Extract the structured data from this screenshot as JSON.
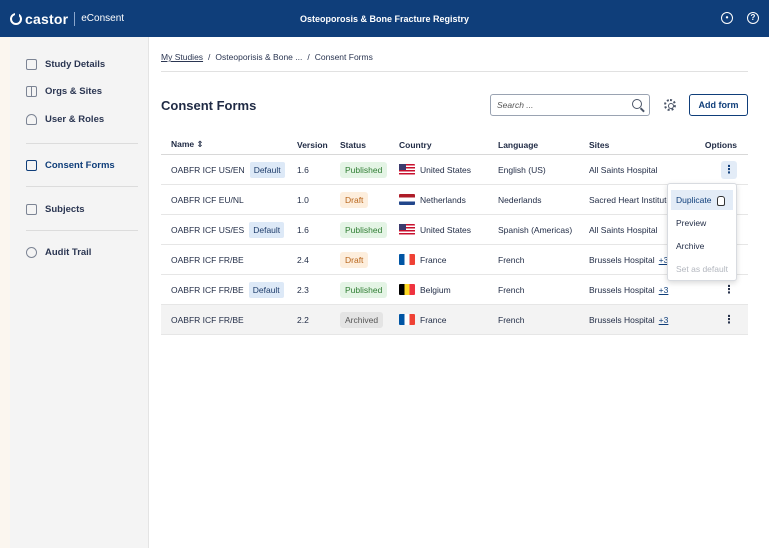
{
  "header": {
    "brand": "castor",
    "product": "eConsent",
    "study_title": "Osteoporosis & Bone Fracture Registry"
  },
  "sidebar": {
    "items": [
      {
        "label": "Study Details",
        "icon": "document-icon"
      },
      {
        "label": "Orgs & Sites",
        "icon": "building-icon"
      },
      {
        "label": "User & Roles",
        "icon": "people-icon"
      },
      {
        "label": "Consent Forms",
        "icon": "clipboard-icon",
        "active": true
      },
      {
        "label": "Subjects",
        "icon": "list-icon"
      },
      {
        "label": "Audit Trail",
        "icon": "clock-icon"
      }
    ]
  },
  "breadcrumb": {
    "root": "My Studies",
    "study": "Osteoporisis & Bone ...",
    "current": "Consent Forms",
    "separator": "/"
  },
  "page": {
    "title": "Consent Forms",
    "search_placeholder": "Search ...",
    "add_button": "Add form"
  },
  "table": {
    "headers": {
      "name": "Name ⇕",
      "version": "Version",
      "status": "Status",
      "country": "Country",
      "language": "Language",
      "sites": "Sites",
      "options": "Options"
    },
    "rows": [
      {
        "name": "OABFR ICF US/EN",
        "default": "Default",
        "version": "1.6",
        "status": "Published",
        "country": "United States",
        "flag": "us",
        "language": "English (US)",
        "sites": "All Saints Hospital",
        "more": ""
      },
      {
        "name": "OABFR ICF EU/NL",
        "default": "",
        "version": "1.0",
        "status": "Draft",
        "country": "Netherlands",
        "flag": "nl",
        "language": "Nederlands",
        "sites": "Sacred Heart Institute",
        "more": ""
      },
      {
        "name": "OABFR ICF US/ES",
        "default": "Default",
        "version": "1.6",
        "status": "Published",
        "country": "United States",
        "flag": "us",
        "language": "Spanish (Americas)",
        "sites": "All Saints Hospital",
        "more": ""
      },
      {
        "name": "OABFR ICF FR/BE",
        "default": "",
        "version": "2.4",
        "status": "Draft",
        "country": "France",
        "flag": "fr",
        "language": "French",
        "sites": "Brussels Hospital",
        "more": "+3"
      },
      {
        "name": "OABFR ICF FR/BE",
        "default": "Default",
        "version": "2.3",
        "status": "Published",
        "country": "Belgium",
        "flag": "be",
        "language": "French",
        "sites": "Brussels Hospital",
        "more": "+3"
      },
      {
        "name": "OABFR ICF FR/BE",
        "default": "",
        "version": "2.2",
        "status": "Archived",
        "country": "France",
        "flag": "fr",
        "language": "French",
        "sites": "Brussels Hospital",
        "more": "+3"
      }
    ],
    "kebab": "⋮"
  },
  "options_menu": {
    "items": [
      {
        "label": "Duplicate",
        "state": "hover"
      },
      {
        "label": "Preview",
        "state": "normal"
      },
      {
        "label": "Archive",
        "state": "normal"
      },
      {
        "label": "Set as default",
        "state": "disabled"
      }
    ]
  },
  "colors": {
    "header_bg": "#0f3e7a",
    "published": "#2e7d32",
    "draft": "#b86419",
    "archived": "#555555"
  }
}
